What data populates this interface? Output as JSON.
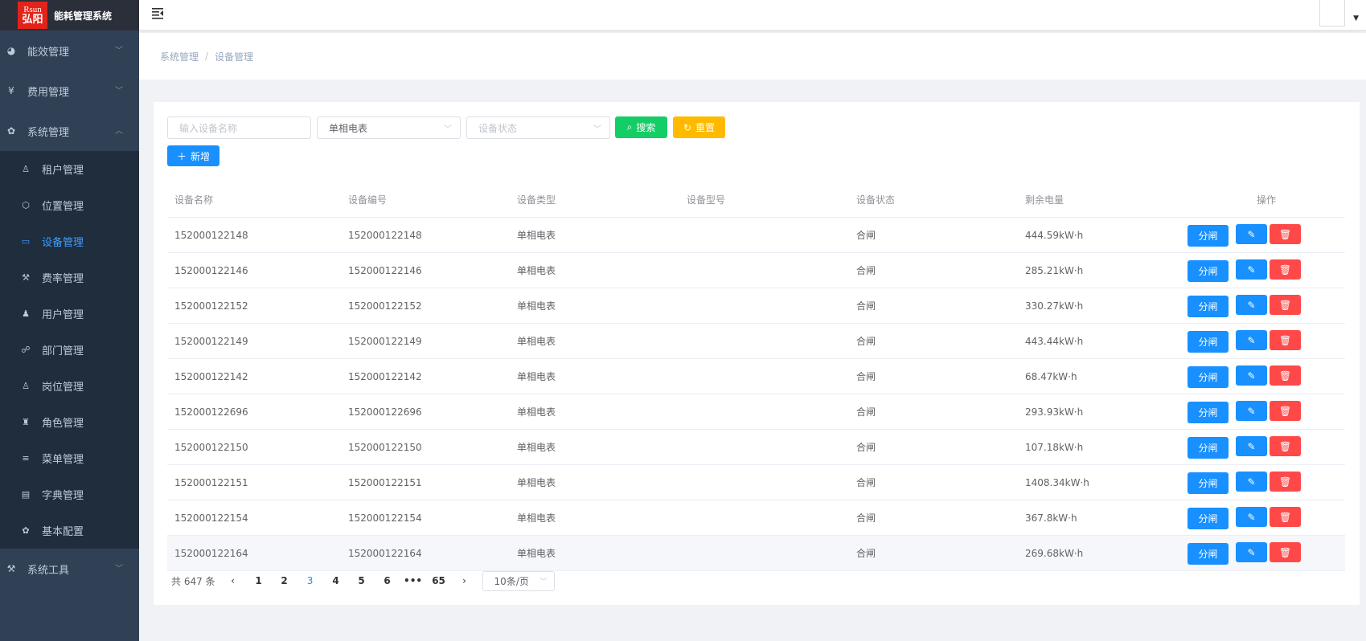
{
  "app": {
    "logo_line1": "Rsun",
    "logo_line2": "弘阳",
    "title": "能耗管理系统"
  },
  "sidebar": {
    "top_items": [
      {
        "label": "能效管理",
        "icon": "dashboard-icon",
        "expanded": false
      },
      {
        "label": "费用管理",
        "icon": "yen-icon",
        "expanded": false
      },
      {
        "label": "系统管理",
        "icon": "gear-icon",
        "expanded": true
      }
    ],
    "sub_items": [
      {
        "label": "租户管理",
        "icon": "tenant-icon",
        "active": false
      },
      {
        "label": "位置管理",
        "icon": "location-icon",
        "active": false
      },
      {
        "label": "设备管理",
        "icon": "device-icon",
        "active": true
      },
      {
        "label": "费率管理",
        "icon": "rate-icon",
        "active": false
      },
      {
        "label": "用户管理",
        "icon": "users-icon",
        "active": false
      },
      {
        "label": "部门管理",
        "icon": "department-icon",
        "active": false
      },
      {
        "label": "岗位管理",
        "icon": "post-icon",
        "active": false
      },
      {
        "label": "角色管理",
        "icon": "role-icon",
        "active": false
      },
      {
        "label": "菜单管理",
        "icon": "menu-icon",
        "active": false
      },
      {
        "label": "字典管理",
        "icon": "dictionary-icon",
        "active": false
      },
      {
        "label": "基本配置",
        "icon": "config-icon",
        "active": false
      }
    ],
    "bottom_items": [
      {
        "label": "系统工具",
        "icon": "tools-icon",
        "expanded": false
      }
    ]
  },
  "breadcrumb": {
    "parent": "系统管理",
    "separator": "/",
    "current": "设备管理"
  },
  "filters": {
    "name_placeholder": "输入设备名称",
    "type_value": "单相电表",
    "status_placeholder": "设备状态",
    "search_label": "搜索",
    "reset_label": "重置",
    "add_label": "新增"
  },
  "table": {
    "headers": [
      "设备名称",
      "设备编号",
      "设备类型",
      "设备型号",
      "设备状态",
      "剩余电量",
      "操作"
    ],
    "action_split_label": "分闸",
    "rows": [
      {
        "name": "152000122148",
        "code": "152000122148",
        "type": "单相电表",
        "model": "",
        "status": "合闸",
        "remaining": "444.59kW·h"
      },
      {
        "name": "152000122146",
        "code": "152000122146",
        "type": "单相电表",
        "model": "",
        "status": "合闸",
        "remaining": "285.21kW·h"
      },
      {
        "name": "152000122152",
        "code": "152000122152",
        "type": "单相电表",
        "model": "",
        "status": "合闸",
        "remaining": "330.27kW·h"
      },
      {
        "name": "152000122149",
        "code": "152000122149",
        "type": "单相电表",
        "model": "",
        "status": "合闸",
        "remaining": "443.44kW·h"
      },
      {
        "name": "152000122142",
        "code": "152000122142",
        "type": "单相电表",
        "model": "",
        "status": "合闸",
        "remaining": "68.47kW·h"
      },
      {
        "name": "152000122696",
        "code": "152000122696",
        "type": "单相电表",
        "model": "",
        "status": "合闸",
        "remaining": "293.93kW·h"
      },
      {
        "name": "152000122150",
        "code": "152000122150",
        "type": "单相电表",
        "model": "",
        "status": "合闸",
        "remaining": "107.18kW·h"
      },
      {
        "name": "152000122151",
        "code": "152000122151",
        "type": "单相电表",
        "model": "",
        "status": "合闸",
        "remaining": "1408.34kW·h"
      },
      {
        "name": "152000122154",
        "code": "152000122154",
        "type": "单相电表",
        "model": "",
        "status": "合闸",
        "remaining": "367.8kW·h"
      },
      {
        "name": "152000122164",
        "code": "152000122164",
        "type": "单相电表",
        "model": "",
        "status": "合闸",
        "remaining": "269.68kW·h"
      }
    ]
  },
  "pagination": {
    "total_label": "共 647 条",
    "pages": [
      "1",
      "2",
      "3",
      "4",
      "5",
      "6",
      "•••",
      "65"
    ],
    "current_page": "3",
    "page_size": "10条/页"
  }
}
